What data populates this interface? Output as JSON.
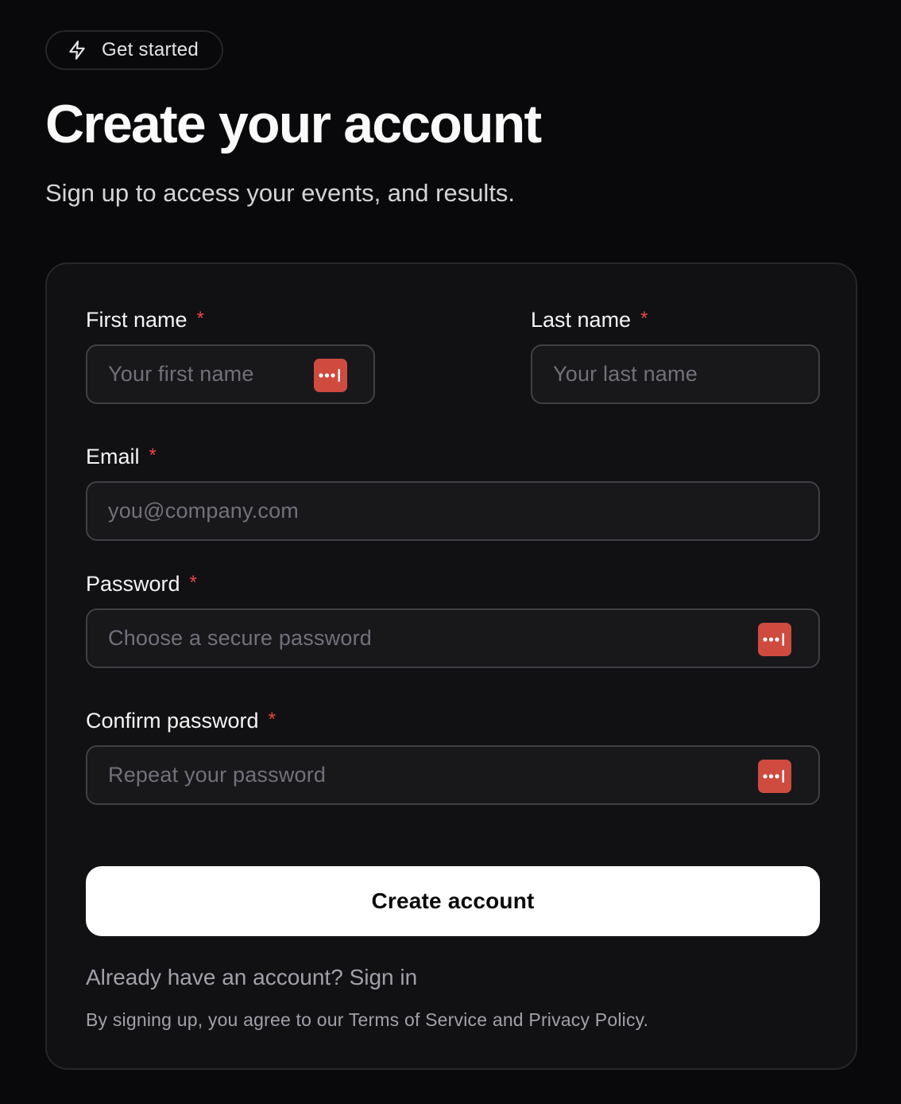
{
  "header": {
    "badge_label": "Get started",
    "badge_icon": "lightning-bolt-icon",
    "title": "Create your account",
    "subtitle": "Sign up to access your events, and results."
  },
  "form": {
    "required_marker": "*",
    "first_name": {
      "label": "First name",
      "placeholder": "Your first name",
      "value": ""
    },
    "last_name": {
      "label": "Last name",
      "placeholder": "Your last name",
      "value": ""
    },
    "email": {
      "label": "Email",
      "placeholder": "you@company.com",
      "value": ""
    },
    "password": {
      "label": "Password",
      "placeholder": "Choose a secure password",
      "value": ""
    },
    "confirm_password": {
      "label": "Confirm password",
      "placeholder": "Repeat your password",
      "value": ""
    },
    "password_manager_icon": "password-manager-icon",
    "submit_label": "Create account"
  },
  "footer": {
    "signin_prompt": "Already have an account?",
    "signin_link": "Sign in",
    "legal_prefix": "By signing up, you agree to our",
    "terms_link": "Terms of Service",
    "legal_and": "and",
    "privacy_link": "Privacy Policy",
    "legal_suffix": "."
  },
  "colors": {
    "background": "#09090b",
    "card": "#111113",
    "required": "#ef4444",
    "password_manager": "#cf4a3f",
    "button": "#ffffff"
  }
}
